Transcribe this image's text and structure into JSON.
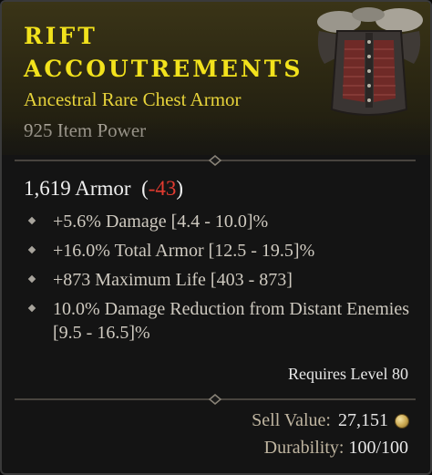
{
  "item": {
    "title_line1": "RIFT",
    "title_line2": "ACCOUTREMENTS",
    "type": "Ancestral Rare Chest Armor",
    "item_power": "925 Item Power",
    "armor_value": "1,619 Armor",
    "armor_delta_open": "(",
    "armor_delta": "-43",
    "armor_delta_close": ")",
    "affixes": [
      "+5.6% Damage [4.4 - 10.0]%",
      "+16.0% Total Armor [12.5 - 19.5]%",
      "+873 Maximum Life [403 - 873]",
      "10.0% Damage Reduction from Distant Enemies [9.5 - 16.5]%"
    ],
    "requires_level": "Requires Level 80",
    "sell_label": "Sell Value:",
    "sell_value": "27,151",
    "durability_label": "Durability:",
    "durability_value": "100/100",
    "icons": {
      "armor": "chest-armor-icon",
      "gold": "gold-coin-icon",
      "bullet": "diamond-bullet-icon"
    },
    "colors": {
      "title": "#f2e21c",
      "rarity": "#e6d23a",
      "negative": "#e23b30"
    }
  }
}
